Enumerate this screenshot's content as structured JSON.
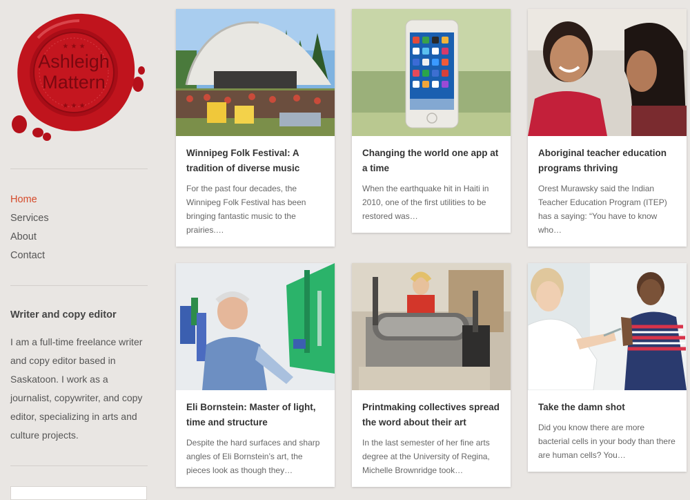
{
  "site": {
    "logo_line1": "Ashleigh",
    "logo_line2": "Mattern",
    "logo_color": "#c8141c"
  },
  "nav": {
    "items": [
      {
        "label": "Home",
        "active": true
      },
      {
        "label": "Services",
        "active": false
      },
      {
        "label": "About",
        "active": false
      },
      {
        "label": "Contact",
        "active": false
      }
    ]
  },
  "widget": {
    "title": "Writer and copy editor",
    "text": "I am a full-time freelance writer and copy editor based in Saskatoon. I work as a journalist, copywriter, and copy editor, specializing in arts and culture projects."
  },
  "posts": [
    {
      "title": "Winnipeg Folk Festival: A tradition of diverse music",
      "excerpt": "For the past four decades, the Winnipeg Folk Festival has been bringing fantastic music to the prairies.…"
    },
    {
      "title": "Changing the world one app at a time",
      "excerpt": "When the earthquake hit in Haiti in 2010, one of the first utilities to be restored was…"
    },
    {
      "title": "Aboriginal teacher education programs thriving",
      "excerpt": "Orest Murawsky said the Indian Teacher Education Program (ITEP) has a saying: “You have to know who…"
    },
    {
      "title": "Eli Bornstein: Master of light, time and structure",
      "excerpt": "Despite the hard surfaces and sharp angles of Eli Bornstein’s art, the pieces look as though they…"
    },
    {
      "title": "Printmaking collectives spread the word about their art",
      "excerpt": "In the last semester of her fine arts degree at the University of Regina, Michelle Brownridge took…"
    },
    {
      "title": "Take the damn shot",
      "excerpt": "Did you know there are more bacterial cells in your body than there are human cells? You…"
    }
  ],
  "colors": {
    "background": "#e9e6e3",
    "accent": "#d54a2a"
  }
}
